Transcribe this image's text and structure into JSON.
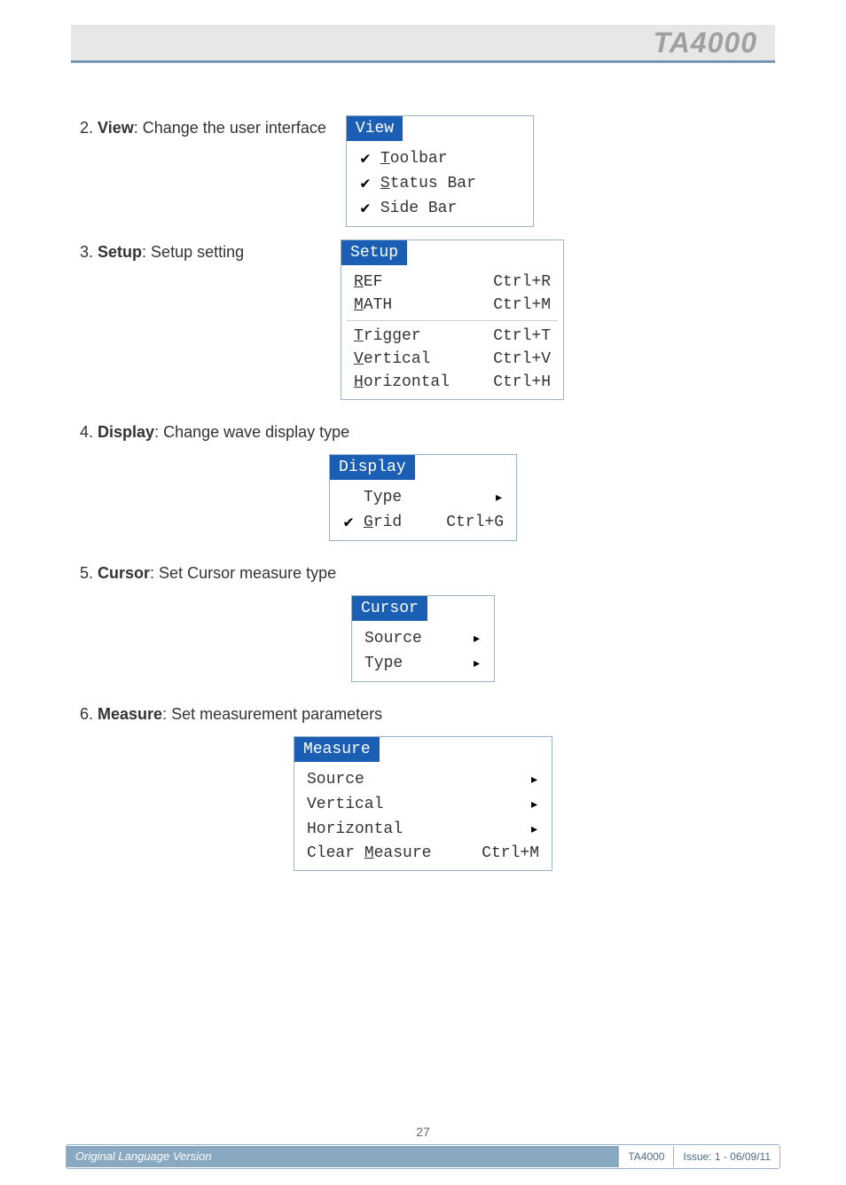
{
  "header": {
    "product": "TA4000"
  },
  "body": {
    "sec2": {
      "num": "2.",
      "name": "View",
      "rest": ": Change the user interface"
    },
    "sec3": {
      "num": "3.",
      "name": "Setup",
      "rest": ": Setup setting"
    },
    "sec4": {
      "num": "4.",
      "name": "Display",
      "rest": ": Change wave display type"
    },
    "sec5": {
      "num": "5.",
      "name": "Cursor",
      "rest": ": Set Cursor measure type"
    },
    "sec6": {
      "num": "6.",
      "name": "Measure",
      "rest": ": Set measurement parameters"
    }
  },
  "menus": {
    "view": {
      "title_pre": "V",
      "title_rest": "iew",
      "items": [
        {
          "check": "✔",
          "u": "T",
          "rest": "oolbar"
        },
        {
          "check": "✔",
          "u": "S",
          "rest": "tatus Bar"
        },
        {
          "check": "✔",
          "u": "",
          "rest": "Side Bar"
        }
      ]
    },
    "setup": {
      "title_pre": "S",
      "title_rest": "etup",
      "g1": [
        {
          "u": "R",
          "rest": "EF",
          "sc": "Ctrl+R"
        },
        {
          "u": "M",
          "rest": "ATH",
          "sc": "Ctrl+M"
        }
      ],
      "g2": [
        {
          "u": "T",
          "rest": "rigger",
          "sc": "Ctrl+T"
        },
        {
          "u": "V",
          "rest": "ertical",
          "sc": "Ctrl+V"
        },
        {
          "u": "H",
          "rest": "orizontal",
          "sc": "Ctrl+H"
        }
      ]
    },
    "display": {
      "title_pre": "D",
      "title_rest": "isplay",
      "items": [
        {
          "check": "",
          "label": "Type",
          "arrow": "▸"
        },
        {
          "check": "✔",
          "u": "G",
          "rest": "rid",
          "sc": "Ctrl+G"
        }
      ]
    },
    "cursor": {
      "title_pre": "C",
      "title_rest": "ursor",
      "items": [
        {
          "label": "Source",
          "arrow": "▸"
        },
        {
          "label": "Type",
          "arrow": "▸"
        }
      ]
    },
    "measure": {
      "title_pre": "M",
      "title_rest": "easure",
      "items": [
        {
          "label": "Source",
          "arrow": "▸"
        },
        {
          "label": "Vertical",
          "arrow": "▸"
        },
        {
          "label": "Horizontal",
          "arrow": "▸"
        },
        {
          "pre": "Clear ",
          "u": "M",
          "rest": "easure",
          "sc": "Ctrl+M"
        }
      ]
    }
  },
  "footer": {
    "page": "27",
    "left": "Original Language Version",
    "model": "TA4000",
    "issue": "Issue: 1 - 06/09/11"
  }
}
